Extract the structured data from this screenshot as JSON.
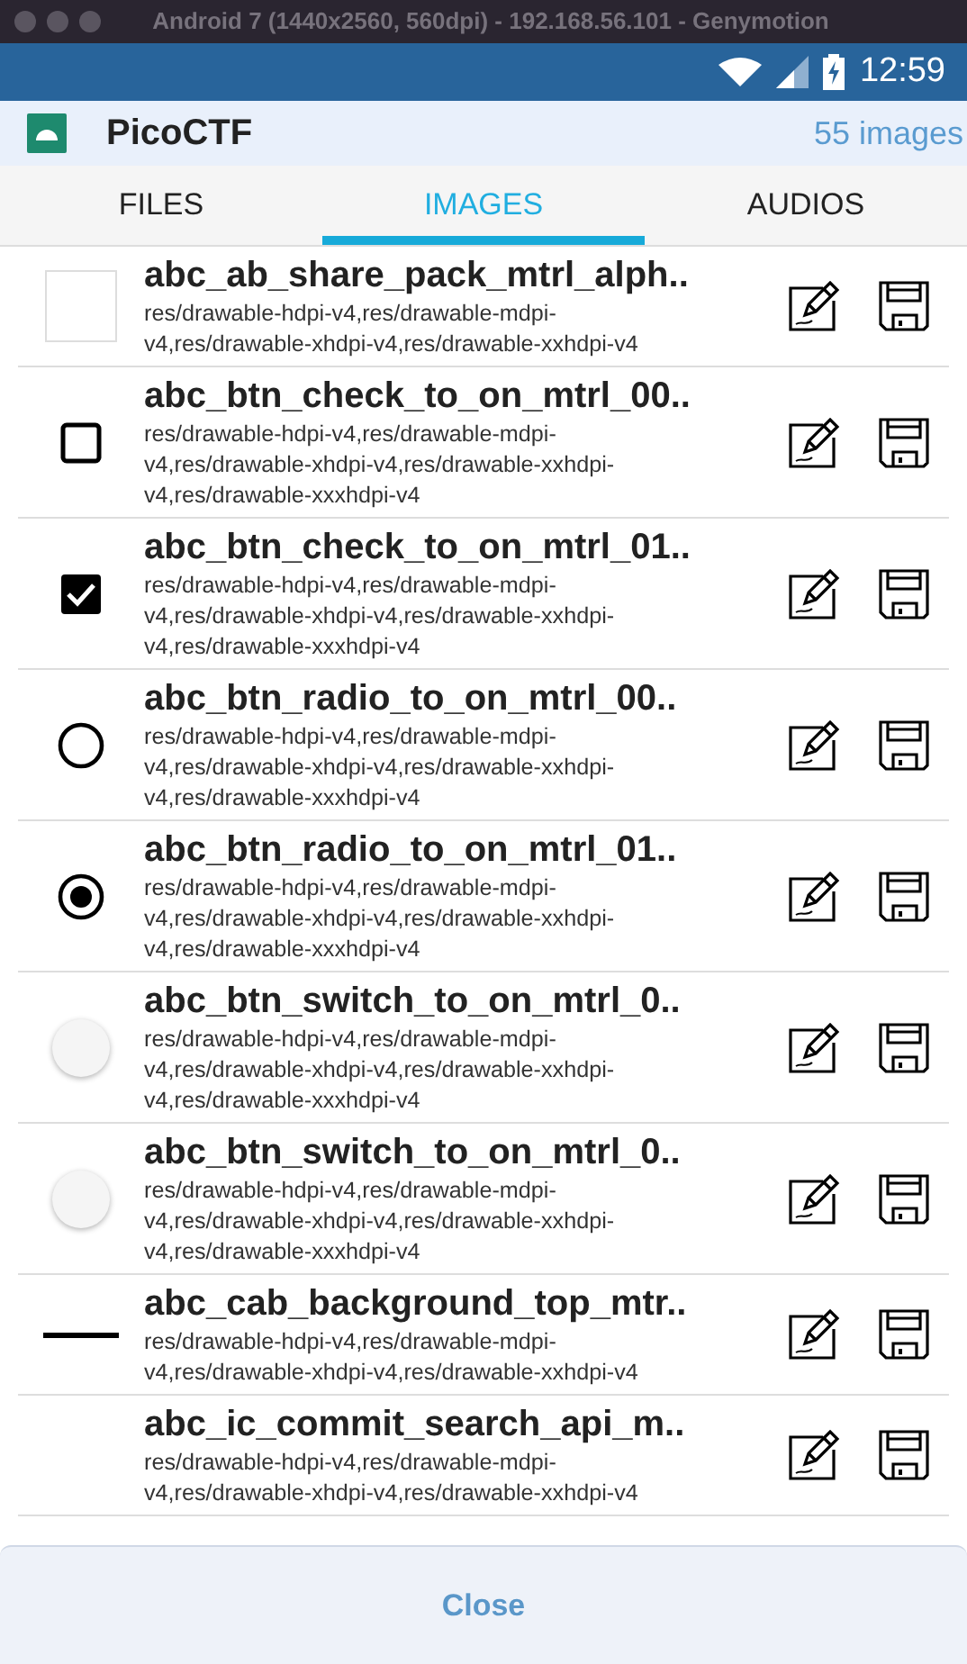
{
  "window": {
    "title": "Android 7 (1440x2560, 560dpi) - 192.168.56.101 - Genymotion"
  },
  "status_bar": {
    "time": "12:59"
  },
  "app_bar": {
    "title": "PicoCTF",
    "count": "55 images"
  },
  "tabs": [
    {
      "label": "FILES",
      "selected": false
    },
    {
      "label": "IMAGES",
      "selected": true
    },
    {
      "label": "AUDIOS",
      "selected": false
    }
  ],
  "rows": [
    {
      "name": "abc_ab_share_pack_mtrl_alph..",
      "path": "res/drawable-hdpi-v4,res/drawable-mdpi-v4,res/drawable-xhdpi-v4,res/drawable-xxhdpi-v4",
      "thumbnail": {
        "kind": "frame"
      }
    },
    {
      "name": "abc_btn_check_to_on_mtrl_00..",
      "path": "res/drawable-hdpi-v4,res/drawable-mdpi-v4,res/drawable-xhdpi-v4,res/drawable-xxhdpi-v4,res/drawable-xxxhdpi-v4",
      "thumbnail": {
        "kind": "checkbox",
        "checked": false
      }
    },
    {
      "name": "abc_btn_check_to_on_mtrl_01..",
      "path": "res/drawable-hdpi-v4,res/drawable-mdpi-v4,res/drawable-xhdpi-v4,res/drawable-xxhdpi-v4,res/drawable-xxxhdpi-v4",
      "thumbnail": {
        "kind": "checkbox",
        "checked": true
      }
    },
    {
      "name": "abc_btn_radio_to_on_mtrl_00..",
      "path": "res/drawable-hdpi-v4,res/drawable-mdpi-v4,res/drawable-xhdpi-v4,res/drawable-xxhdpi-v4,res/drawable-xxxhdpi-v4",
      "thumbnail": {
        "kind": "radio",
        "checked": false
      }
    },
    {
      "name": "abc_btn_radio_to_on_mtrl_01..",
      "path": "res/drawable-hdpi-v4,res/drawable-mdpi-v4,res/drawable-xhdpi-v4,res/drawable-xxhdpi-v4,res/drawable-xxxhdpi-v4",
      "thumbnail": {
        "kind": "radio",
        "checked": true
      }
    },
    {
      "name": "abc_btn_switch_to_on_mtrl_0..",
      "path": "res/drawable-hdpi-v4,res/drawable-mdpi-v4,res/drawable-xhdpi-v4,res/drawable-xxhdpi-v4,res/drawable-xxxhdpi-v4",
      "thumbnail": {
        "kind": "knob"
      }
    },
    {
      "name": "abc_btn_switch_to_on_mtrl_0..",
      "path": "res/drawable-hdpi-v4,res/drawable-mdpi-v4,res/drawable-xhdpi-v4,res/drawable-xxhdpi-v4,res/drawable-xxxhdpi-v4",
      "thumbnail": {
        "kind": "knob"
      }
    },
    {
      "name": "abc_cab_background_top_mtr..",
      "path": "res/drawable-hdpi-v4,res/drawable-mdpi-v4,res/drawable-xhdpi-v4,res/drawable-xxhdpi-v4",
      "thumbnail": {
        "kind": "line"
      }
    },
    {
      "name": "abc_ic_commit_search_api_m..",
      "path": "res/drawable-hdpi-v4,res/drawable-mdpi-v4,res/drawable-xhdpi-v4,res/drawable-xxhdpi-v4",
      "thumbnail": {
        "kind": "empty"
      }
    }
  ],
  "close_button": {
    "label": "Close"
  }
}
